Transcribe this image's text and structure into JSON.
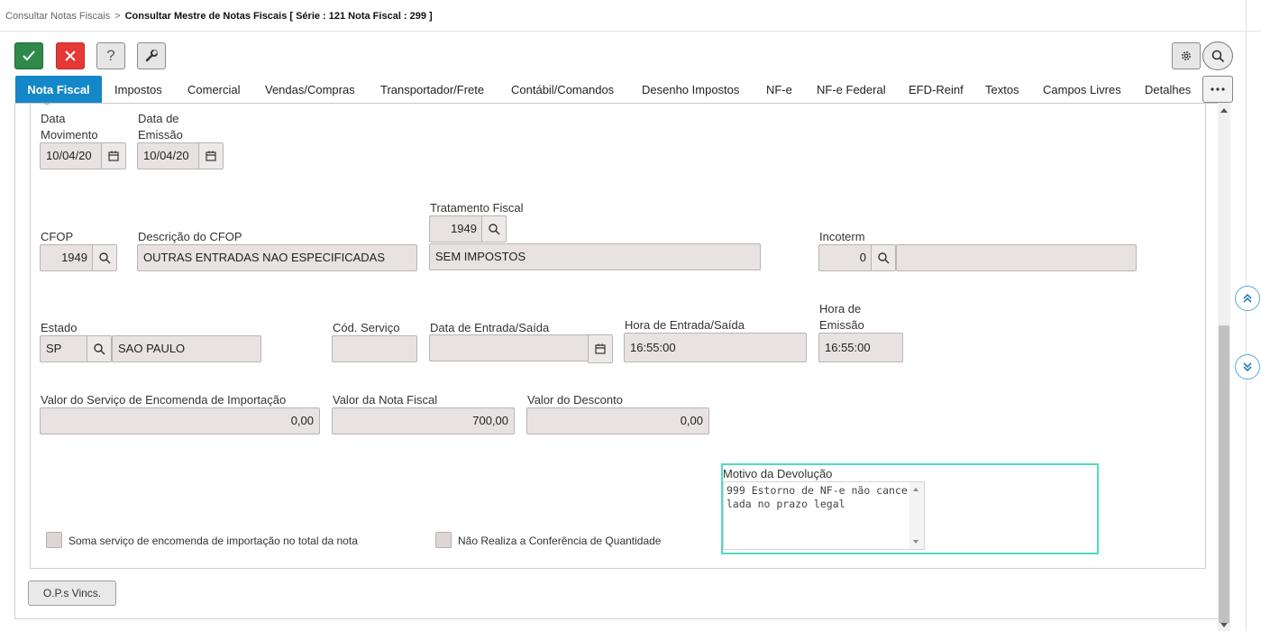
{
  "breadcrumb": {
    "parent": "Consultar Notas Fiscais",
    "separator": ">",
    "current": "Consultar Mestre de Notas Fiscais [ Série : 121 Nota Fiscal : 299 ]"
  },
  "toolbar": {
    "confirm_icon": "check-icon",
    "cancel_icon": "close-icon",
    "help_label": "?",
    "tools_icon": "wrench-icon",
    "settings_icon": "gear-icon",
    "search_icon": "search-icon"
  },
  "tabs": [
    {
      "label": "Nota Fiscal",
      "active": true
    },
    {
      "label": "Impostos"
    },
    {
      "label": "Comercial"
    },
    {
      "label": "Vendas/Compras"
    },
    {
      "label": "Transportador/Frete"
    },
    {
      "label": "Contábil/Comandos"
    },
    {
      "label": "Desenho Impostos"
    },
    {
      "label": "NF-e"
    },
    {
      "label": "NF-e Federal"
    },
    {
      "label": "EFD-Reinf"
    },
    {
      "label": "Textos"
    },
    {
      "label": "Campos Livres"
    },
    {
      "label": "Detalhes"
    }
  ],
  "fields": {
    "data_movimento": {
      "label_line1": "Data",
      "label_line2": "Movimento",
      "value": "10/04/20"
    },
    "data_emissao": {
      "label_line1": "Data de",
      "label_line2": "Emissão",
      "value": "10/04/20"
    },
    "tratamento_fiscal": {
      "label": "Tratamento Fiscal",
      "code": "1949",
      "description": "SEM IMPOSTOS"
    },
    "cfop": {
      "label": "CFOP",
      "value": "1949"
    },
    "descricao_cfop": {
      "label": "Descrição do CFOP",
      "value": "OUTRAS ENTRADAS NAO ESPECIFICADAS"
    },
    "incoterm": {
      "label": "Incoterm",
      "value": "0",
      "description": ""
    },
    "estado": {
      "label": "Estado",
      "code": "SP",
      "name": "SAO PAULO"
    },
    "cod_servico": {
      "label": "Cód. Serviço",
      "value": ""
    },
    "data_entrada_saida": {
      "label": "Data de Entrada/Saída",
      "value": ""
    },
    "hora_entrada_saida": {
      "label": "Hora de Entrada/Saída",
      "value": "16:55:00"
    },
    "hora_emissao": {
      "label_line1": "Hora de",
      "label_line2": "Emissão",
      "value": "16:55:00"
    },
    "valor_servico_encomenda": {
      "label": "Valor do Serviço de Encomenda de Importação",
      "value": "0,00"
    },
    "valor_nota_fiscal": {
      "label": "Valor da Nota Fiscal",
      "value": "700,00"
    },
    "valor_desconto": {
      "label": "Valor do Desconto",
      "value": "0,00"
    },
    "motivo_devolucao": {
      "label": "Motivo da Devolução",
      "value": "999 Estorno de NF-e não cancelada no prazo legal"
    }
  },
  "checkboxes": {
    "soma_servico": {
      "label": "Soma serviço de encomenda de importação no total da nota",
      "checked": false
    },
    "nao_realiza_conferencia": {
      "label": "Não Realiza a Conferência de Quantidade",
      "checked": false
    }
  },
  "buttons": {
    "ops_vincs": "O.P.s Vincs."
  },
  "colors": {
    "active_tab": "#1387c8",
    "confirm": "#2e8a4a",
    "cancel": "#e53935",
    "focus_border": "#4fdcbf",
    "field_bg": "#e9e2e2"
  }
}
